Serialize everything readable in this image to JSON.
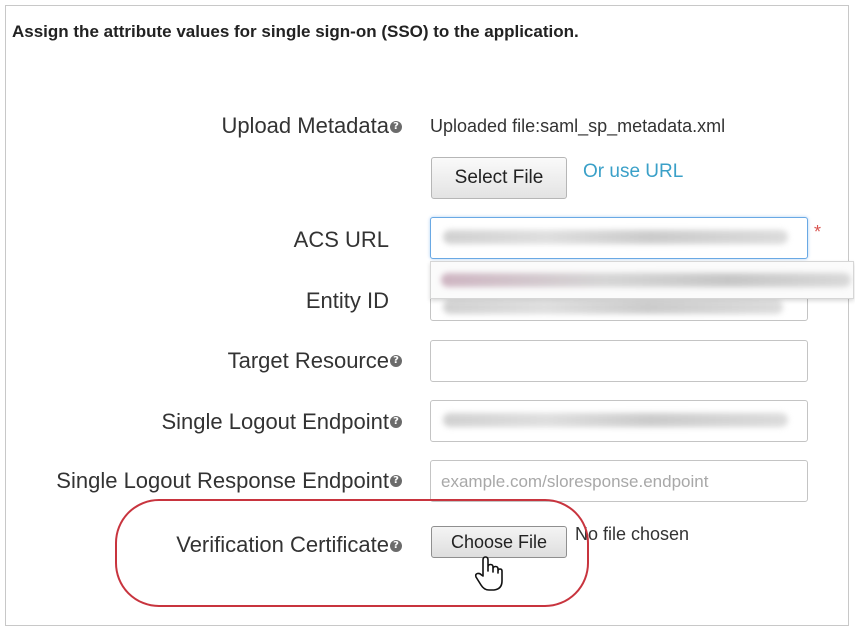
{
  "heading": "Assign the attribute values for single sign-on (SSO) to the application.",
  "help_glyph": "?",
  "upload_metadata": {
    "label": "Upload Metadata",
    "uploaded_file": "Uploaded file:saml_sp_metadata.xml",
    "select_file_button": "Select File",
    "use_url_link": "Or use URL"
  },
  "acs_url": {
    "label": "ACS URL",
    "value_redacted": true,
    "required_marker": "*"
  },
  "autocomplete": {
    "suggestion_redacted": true
  },
  "entity_id": {
    "label": "Entity ID",
    "value_redacted": true
  },
  "target_resource": {
    "label": "Target Resource",
    "value": ""
  },
  "single_logout_endpoint": {
    "label": "Single Logout Endpoint",
    "value_redacted": true
  },
  "single_logout_response_endpoint": {
    "label": "Single Logout Response Endpoint",
    "placeholder": "example.com/sloresponse.endpoint"
  },
  "verification_certificate": {
    "label": "Verification Certificate",
    "choose_file_button": "Choose File",
    "status": "No file chosen"
  },
  "colors": {
    "link": "#3aa0c8",
    "highlight": "#c8343e",
    "required": "#d9534f",
    "focus": "#6aa9e4"
  }
}
